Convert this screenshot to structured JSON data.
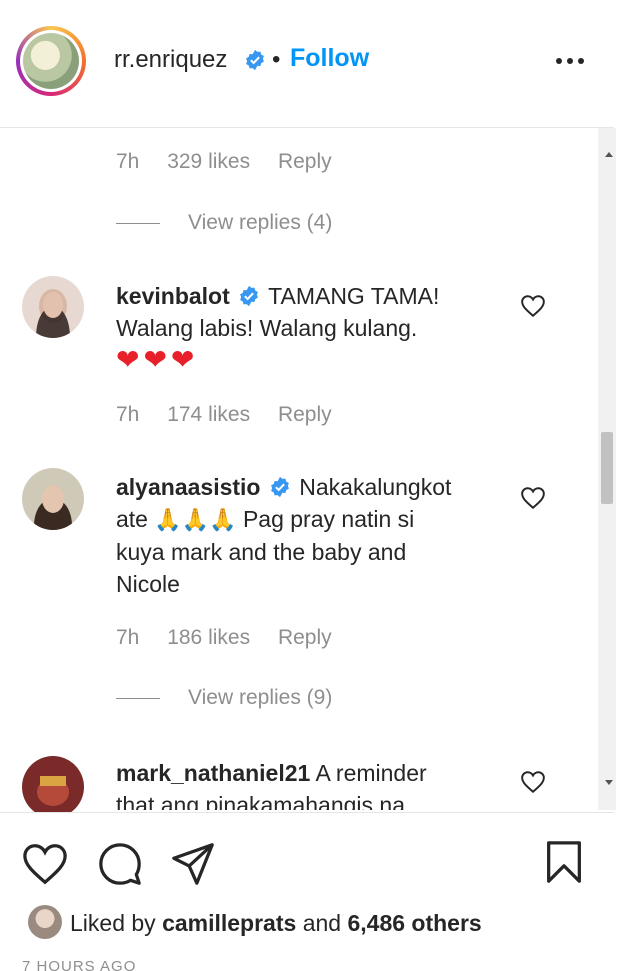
{
  "header": {
    "username": "rr.enriquez",
    "separator": "•",
    "follow_label": "Follow"
  },
  "comments": [
    {
      "meta": {
        "time": "7h",
        "likes": "329 likes",
        "reply": "Reply"
      },
      "view_replies": "View replies (4)"
    },
    {
      "username": "kevinbalot",
      "text_line1": "TAMANG TAMA!",
      "text_line2": "Walang labis! Walang kulang.",
      "emoji": "❤❤❤",
      "meta": {
        "time": "7h",
        "likes": "174 likes",
        "reply": "Reply"
      }
    },
    {
      "username": "alyanaasistio",
      "text_line1": "Nakakalungkot",
      "text_line2a": "ate",
      "text_line2_emoji": "🙏🙏🙏",
      "text_line2b": "Pag pray natin si",
      "text_line3": "kuya mark and the baby and",
      "text_line4": "Nicole",
      "meta": {
        "time": "7h",
        "likes": "186 likes",
        "reply": "Reply"
      },
      "view_replies": "View replies (9)"
    },
    {
      "username": "mark_nathaniel21",
      "text_line1": "A reminder",
      "text_line2": "that ang pinakamahangis na"
    }
  ],
  "actions": {
    "like_icon": "heart-icon",
    "comment_icon": "comment-icon",
    "share_icon": "paper-plane-icon",
    "save_icon": "bookmark-icon"
  },
  "likes_summary": {
    "prefix": "Liked by",
    "user": "camilleprats",
    "middle": "and",
    "others": "6,486 others"
  },
  "timestamp": "7 HOURS AGO",
  "colors": {
    "link": "#0095f6",
    "muted": "#8e8e8e",
    "text": "#262626",
    "verified": "#3897f0",
    "heart": "#e8202a"
  }
}
